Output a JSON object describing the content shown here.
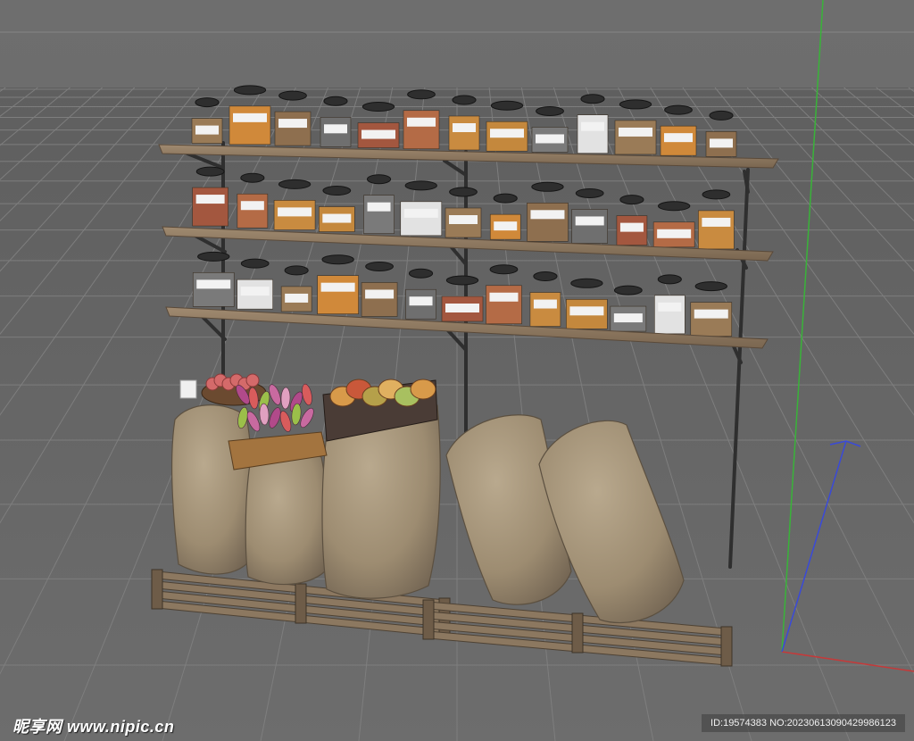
{
  "viewport": {
    "background": "#6a6a6a",
    "grid_color": "#808080",
    "axis_colors": {
      "y": "#39b339",
      "x": "#c43a3a",
      "z": "#3a4ad8"
    }
  },
  "scene": {
    "objects": [
      {
        "name": "wall-shelf-unit",
        "shelves": 3
      },
      {
        "name": "spice-jars",
        "material": "glass with black lids"
      },
      {
        "name": "burlap-sacks",
        "count": 5
      },
      {
        "name": "wooden-pallets",
        "count": 2
      },
      {
        "name": "vegetable-crate"
      },
      {
        "name": "fruit-basket"
      },
      {
        "name": "apple-bucket"
      }
    ]
  },
  "watermark": {
    "site": "昵享网 www.nipic.cn",
    "id": "ID:19574383 NO:20230613090429986123"
  }
}
